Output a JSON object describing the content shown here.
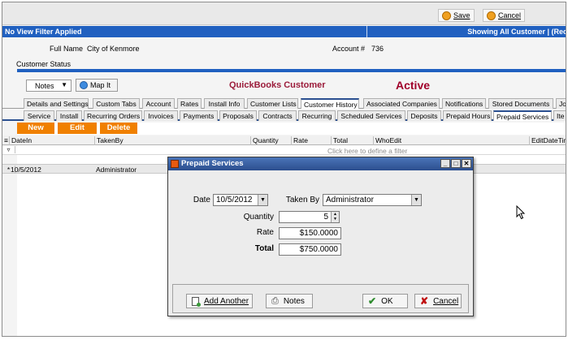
{
  "toolbar": {
    "save_label": "Save",
    "cancel_label": "Cancel"
  },
  "filter_bar": {
    "left_text": "No View Filter Applied",
    "right_text": "Showing All Customer  |  (Rec"
  },
  "customer": {
    "full_name_label": "Full Name",
    "full_name_value": "City of Kenmore",
    "account_label": "Account #",
    "account_value": "736",
    "status_label": "Customer Status"
  },
  "controls": {
    "notes_select": "Notes",
    "map_button": "Map It"
  },
  "banner": {
    "quickbooks": "QuickBooks Customer",
    "status": "Active"
  },
  "tabs_row1": [
    "Details and Settings",
    "Custom Tabs",
    "Account",
    "Rates",
    "Install Info",
    "Customer Lists",
    "Customer History",
    "Associated Companies",
    "Notifications",
    "Stored Documents",
    "Jo"
  ],
  "tabs_row2": [
    "Service",
    "Install",
    "Recurring Orders",
    "Invoices",
    "Payments",
    "Proposals",
    "Contracts",
    "Recurring",
    "Scheduled Services",
    "Deposits",
    "Prepaid Hours",
    "Prepaid Services",
    "Ite"
  ],
  "actions": {
    "new": "New",
    "edit": "Edit",
    "delete": "Delete"
  },
  "grid": {
    "columns": [
      "DateIn",
      "TakenBy",
      "Quantity",
      "Rate",
      "Total",
      "WhoEdit",
      "EditDateTim"
    ],
    "filter_hint": "Click here to define a filter",
    "rows": [
      {
        "indicator": "*",
        "date_in": "10/5/2012",
        "taken_by": "Administrator"
      }
    ]
  },
  "dialog": {
    "title": "Prepaid Services",
    "date_label": "Date",
    "date_value": "10/5/2012",
    "taken_by_label": "Taken By",
    "taken_by_value": "Administrator",
    "quantity_label": "Quantity",
    "quantity_value": "5",
    "rate_label": "Rate",
    "rate_value": "$150.0000",
    "total_label": "Total",
    "total_value": "$750.0000",
    "add_another_label": "Add Another",
    "notes_label": "Notes",
    "ok_label": "OK",
    "cancel_label": "Cancel"
  },
  "colors": {
    "accent_blue": "#2060c0",
    "action_orange": "#f08000",
    "title_red": "#9b1b3a"
  }
}
